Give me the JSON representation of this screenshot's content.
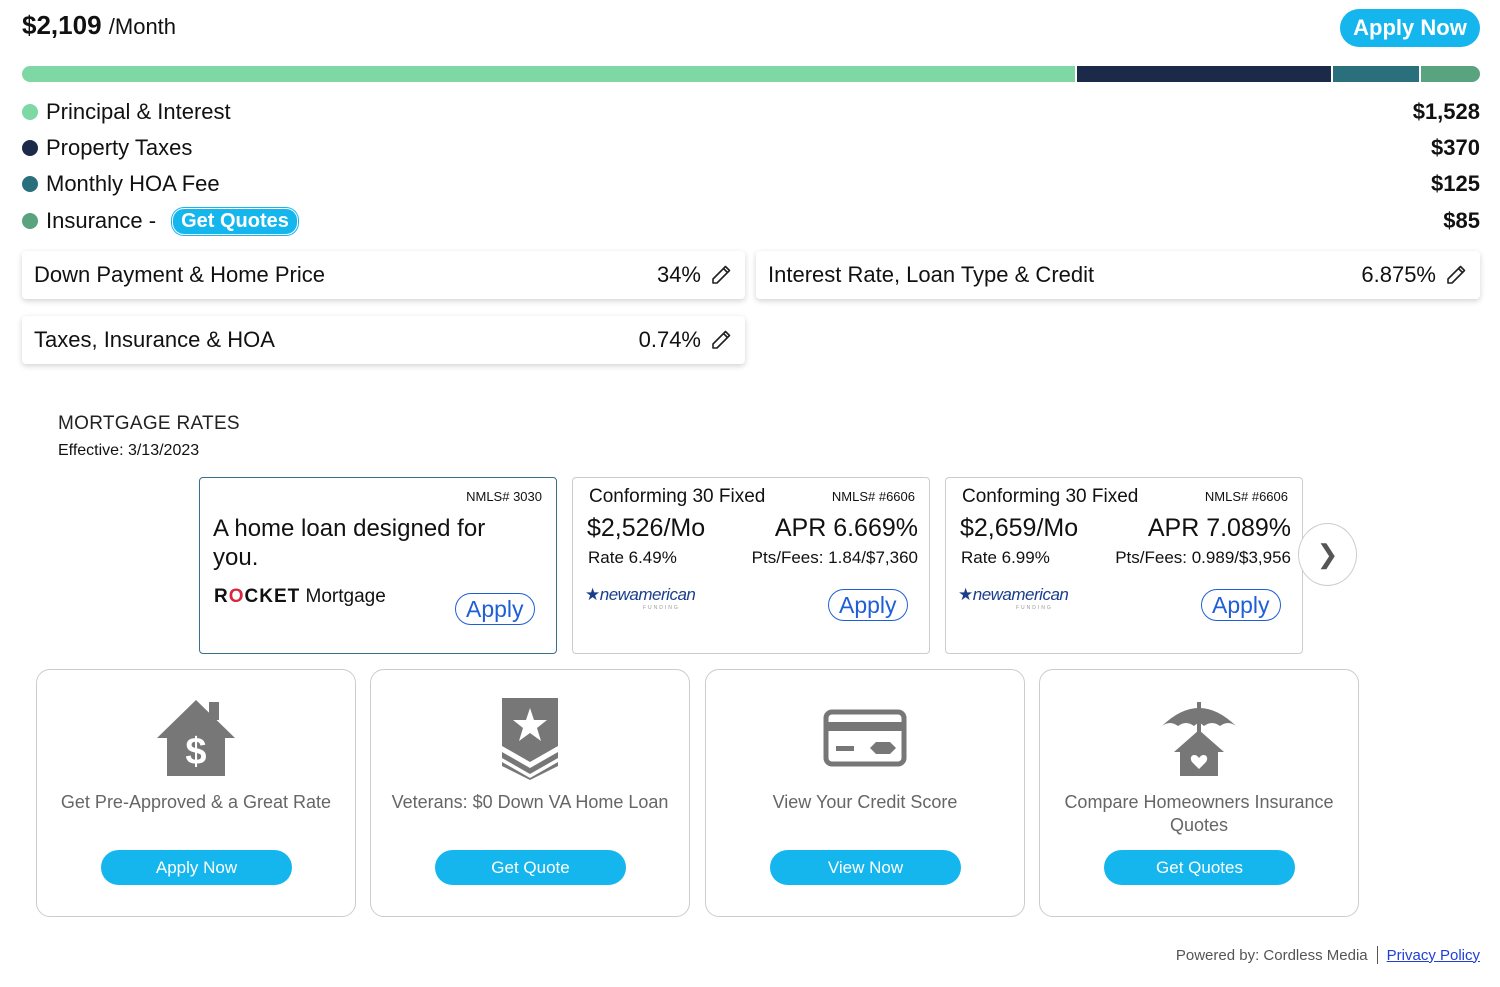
{
  "header": {
    "total": "$2,109",
    "per": "/Month",
    "apply_button": "Apply Now"
  },
  "breakdown": {
    "bar_colors": [
      "#7dd8a4",
      "#1c2a4a",
      "#2a6f7c",
      "#59a37f"
    ],
    "items": [
      {
        "label": "Principal & Interest",
        "value": "$1,528",
        "color": "#7dd8a4",
        "amount": 1528
      },
      {
        "label": "Property Taxes",
        "value": "$370",
        "color": "#1c2a4a",
        "amount": 370
      },
      {
        "label": "Monthly HOA Fee",
        "value": "$125",
        "color": "#2a6f7c",
        "amount": 125
      },
      {
        "label": "Insurance -",
        "value": "$85",
        "color": "#59a37f",
        "amount": 85,
        "link": "Get Quotes"
      }
    ]
  },
  "settings": {
    "down_payment": {
      "label": "Down Payment & Home Price",
      "value": "34%"
    },
    "interest": {
      "label": "Interest Rate, Loan Type & Credit",
      "value": "6.875%"
    },
    "taxes": {
      "label": "Taxes, Insurance & HOA",
      "value": "0.74%"
    }
  },
  "rates": {
    "title": "MORTGAGE RATES",
    "effective": "Effective: 3/13/2023",
    "cards": [
      {
        "nmls": "NMLS# 3030",
        "headline": "A home loan designed for you.",
        "logo_a": "R",
        "logo_o": "O",
        "logo_b": "CKET",
        "logo_c": "Mortgage",
        "apply": "Apply"
      },
      {
        "nmls": "NMLS# #6606",
        "title": "Conforming 30 Fixed",
        "monthly": "$2,526/Mo",
        "apr": "APR 6.669%",
        "rate": "Rate 6.49%",
        "pts": "Pts/Fees: 1.84/$7,360",
        "logo": "newamerican",
        "logo_sub": "FUNDING",
        "apply": "Apply"
      },
      {
        "nmls": "NMLS# #6606",
        "title": "Conforming 30 Fixed",
        "monthly": "$2,659/Mo",
        "apr": "APR 7.089%",
        "rate": "Rate 6.99%",
        "pts": "Pts/Fees: 0.989/$3,956",
        "logo": "newamerican",
        "logo_sub": "FUNDING",
        "apply": "Apply"
      }
    ],
    "next": "❯"
  },
  "promos": [
    {
      "text": "Get Pre-Approved & a Great Rate",
      "button": "Apply Now",
      "icon": "house-dollar-icon"
    },
    {
      "text": "Veterans: $0 Down VA Home Loan",
      "button": "Get Quote",
      "icon": "military-badge-icon"
    },
    {
      "text": "View Your Credit Score",
      "button": "View Now",
      "icon": "credit-card-icon"
    },
    {
      "text": "Compare Homeowners Insurance Quotes",
      "button": "Get Quotes",
      "icon": "umbrella-house-icon"
    }
  ],
  "footer": {
    "powered": "Powered by: Cordless Media",
    "privacy": "Privacy Policy"
  }
}
